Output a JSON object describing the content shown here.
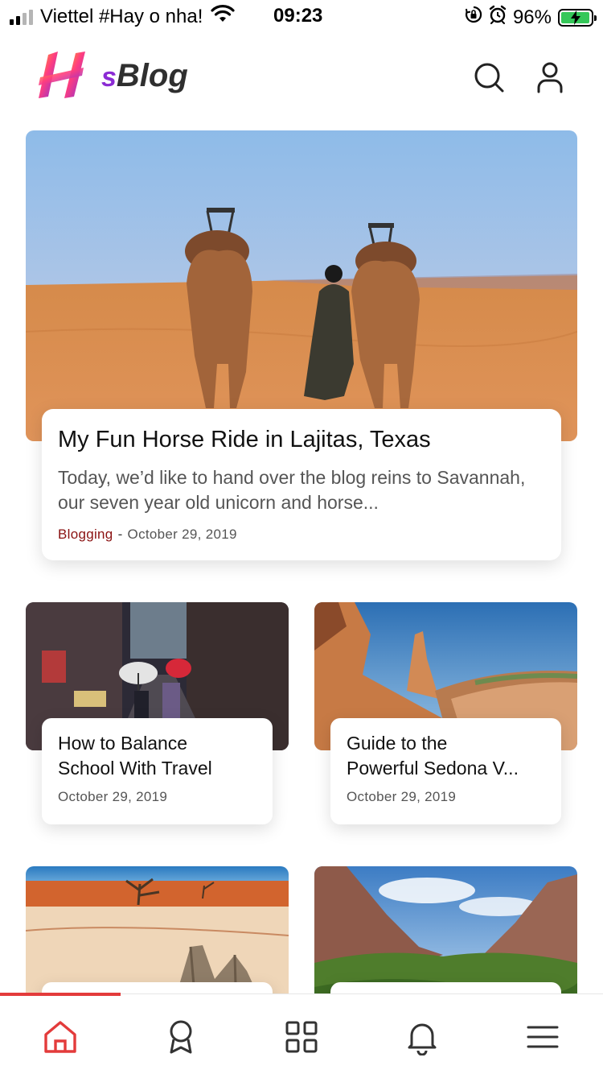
{
  "status_bar": {
    "carrier": "Viettel #Hay o nha!",
    "time": "09:23",
    "battery_percent": "96%",
    "battery_level": 0.96,
    "icons": [
      "signal-icon",
      "wifi-icon",
      "orientation-lock-icon",
      "alarm-icon",
      "battery-charging-icon"
    ]
  },
  "header": {
    "logo_letter": "H",
    "logo_s": "s",
    "logo_text": "Blog",
    "icons": [
      "search-icon",
      "user-icon"
    ]
  },
  "featured": {
    "title": "My Fun Horse Ride in Lajitas, Texas",
    "excerpt": "Today, we’d like to hand over the blog reins to Savannah, our seven year old unicorn and horse...",
    "category": "Blogging",
    "separator": "-",
    "date": "October 29, 2019",
    "image": "desert-camels-photo"
  },
  "posts": [
    {
      "title_line1": "How to Balance",
      "title_line2": "School With Travel",
      "date": "October 29, 2019",
      "image": "japanese-alley-photo"
    },
    {
      "title_line1": "Guide to the",
      "title_line2": "Powerful Sedona V...",
      "date": "October 29, 2019",
      "image": "canyon-rocks-photo"
    },
    {
      "image": "desert-deadvlei-photo"
    },
    {
      "image": "zion-canyon-photo"
    }
  ],
  "bottom_nav": {
    "items": [
      "home-icon",
      "award-icon",
      "grid-icon",
      "bell-icon",
      "menu-icon"
    ],
    "active_index": 0,
    "active_color": "#e33b3b"
  },
  "colors": {
    "category": "#8a1111",
    "accent": "#e33b3b",
    "battery": "#35c759"
  }
}
